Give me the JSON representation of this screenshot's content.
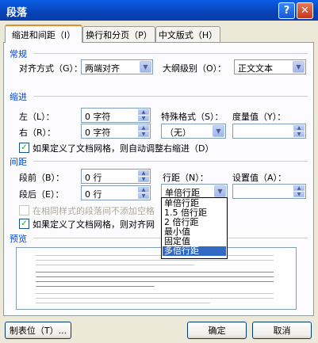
{
  "window": {
    "title": "段落",
    "help_icon": "?",
    "close_icon": "✕"
  },
  "tabs": [
    {
      "label": "缩进和间距（I）",
      "active": true
    },
    {
      "label": "换行和分页（P）",
      "active": false
    },
    {
      "label": "中文版式（H）",
      "active": false
    }
  ],
  "general": {
    "section_label": "常规",
    "alignment_label": "对齐方式（G）：",
    "alignment_value": "两端对齐",
    "outline_label": "大纲级别（O）：",
    "outline_value": "正文文本"
  },
  "indent": {
    "section_label": "缩进",
    "left_label": "左（L）：",
    "left_value": "0 字符",
    "right_label": "右（R）：",
    "right_value": "0 字符",
    "special_label": "特殊格式（S）：",
    "special_value": "（无）",
    "by_label": "度量值（Y）：",
    "by_value": "",
    "grid_checkbox_label": "如果定义了文档网格，则自动调整右缩进（D）",
    "grid_checked": true
  },
  "spacing": {
    "section_label": "间距",
    "before_label": "段前（B）：",
    "before_value": "0 行",
    "after_label": "段后（E）：",
    "after_value": "0 行",
    "line_label": "行距（N）：",
    "line_value": "单倍行距",
    "at_label": "设置值（A）：",
    "at_value": "",
    "no_space_label": "在相同样式的段落间不添加空格",
    "no_space_checked": false,
    "snap_label": "如果定义了文档网格，则对齐网",
    "snap_checked": true
  },
  "line_spacing_options": [
    "单倍行距",
    "1.5 倍行距",
    "2 倍行距",
    "最小值",
    "固定值",
    "多倍行距"
  ],
  "line_spacing_highlighted": "多倍行距",
  "preview": {
    "section_label": "预览"
  },
  "buttons": {
    "tabs": "制表位（T）...",
    "ok": "确定",
    "cancel": "取消"
  },
  "colors": {
    "title_bar": "#0842b7",
    "section_label": "#0046d5",
    "highlight": "#316ac5"
  }
}
